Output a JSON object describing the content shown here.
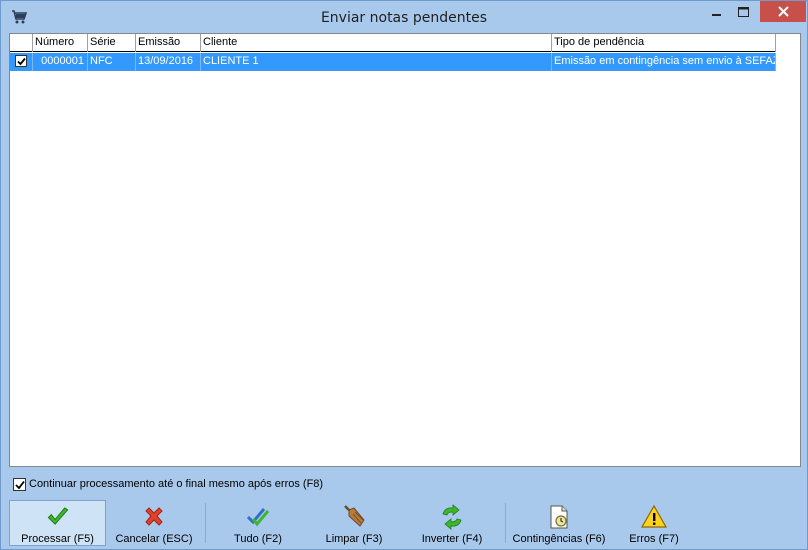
{
  "window": {
    "title": "Enviar notas pendentes"
  },
  "grid": {
    "columns": [
      "Número",
      "Série",
      "Emissão",
      "Cliente",
      "Tipo de pendência"
    ],
    "rows": [
      {
        "checked": true,
        "numero": "0000001",
        "serie": "NFC",
        "emissao": "13/09/2016",
        "cliente": "CLIENTE 1",
        "tipo": "Emissão em contingência sem envio à SEFAZ"
      }
    ]
  },
  "options": {
    "continue_label": "Continuar processamento até o final mesmo após erros  (F8)",
    "continue_checked": true
  },
  "toolbar": {
    "processar": "Processar (F5)",
    "cancelar": "Cancelar (ESC)",
    "tudo": "Tudo (F2)",
    "limpar": "Limpar (F3)",
    "inverter": "Inverter (F4)",
    "contingencias": "Contingências (F6)",
    "erros": "Erros (F7)"
  },
  "colors": {
    "title_bar": "#a9c9ec",
    "selection": "#3399ff",
    "close_button": "#c7504a"
  }
}
